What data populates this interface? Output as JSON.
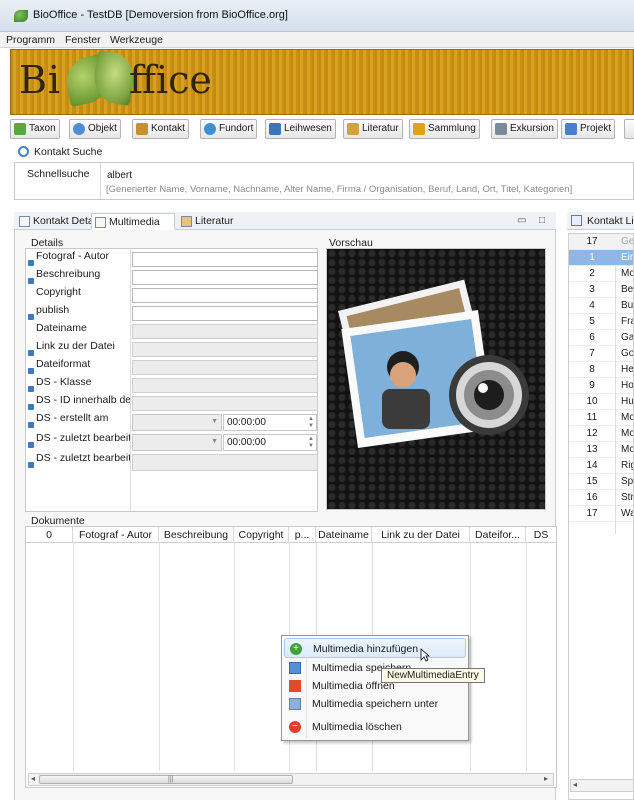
{
  "window": {
    "title": "BioOffice - TestDB [Demoversion from BioOffice.org]"
  },
  "menu": [
    "Programm",
    "Fenster",
    "Werkzeuge"
  ],
  "banner": {
    "wordmark_left": "Bi",
    "wordmark_right": "ffice"
  },
  "toolbar": [
    {
      "label": "Taxon",
      "icon": "taxon-icon",
      "color": "#5aa83c"
    },
    {
      "label": "Objekt",
      "icon": "objekt-icon",
      "color": "#4f8fd6"
    },
    {
      "label": "Kontakt",
      "icon": "kontakt-icon",
      "color": "#c7902a"
    },
    {
      "label": "Fundort",
      "icon": "fundort-icon",
      "color": "#3f8fd0"
    },
    {
      "label": "Leihwesen",
      "icon": "leihwesen-icon",
      "color": "#3a77b8"
    },
    {
      "label": "Literatur",
      "icon": "literatur-icon",
      "color": "#d8a03a"
    },
    {
      "label": "Sammlung",
      "icon": "sammlung-icon",
      "color": "#e0a219"
    },
    {
      "label": "Exkursion",
      "icon": "exkursion-icon",
      "color": "#7a8a99"
    },
    {
      "label": "Projekt",
      "icon": "projekt-icon",
      "color": "#4a7ed0"
    }
  ],
  "search": {
    "tab_label": "Kontakt Suche",
    "quick_label": "Schnellsuche",
    "value": "albert",
    "hint": "[Generierter Name, Vorname, Nachname, Alter Name, Firma / Organisation, Beruf, Land, Ort, Titel, Kategorien]"
  },
  "tabs": [
    {
      "label": "Kontakt Detail",
      "active": false
    },
    {
      "label": "Multimedia",
      "active": true
    },
    {
      "label": "Literatur",
      "active": false
    }
  ],
  "details": {
    "title": "Details",
    "fields": [
      {
        "label": "Fotograf - Autor",
        "info": true,
        "kind": "input"
      },
      {
        "label": "Beschreibung",
        "info": true,
        "kind": "input"
      },
      {
        "label": "Copyright",
        "info": false,
        "kind": "input"
      },
      {
        "label": "publish",
        "info": true,
        "kind": "input"
      },
      {
        "label": "Dateiname",
        "info": false,
        "kind": "readonly"
      },
      {
        "label": "Link zu der Datei",
        "info": true,
        "kind": "readonly"
      },
      {
        "label": "Dateiformat",
        "info": true,
        "kind": "readonly"
      },
      {
        "label": "DS - Klasse",
        "info": true,
        "kind": "readonly"
      },
      {
        "label": "DS - ID innerhalb der",
        "info": true,
        "kind": "readonly"
      },
      {
        "label": "DS - erstellt am",
        "info": true,
        "kind": "datetime",
        "time": "00:00:00"
      },
      {
        "label": "DS - zuletzt bearbeite",
        "info": true,
        "kind": "datetime",
        "time": "00:00:00"
      },
      {
        "label": "DS - zuletzt bearbeite",
        "info": true,
        "kind": "readonly"
      }
    ]
  },
  "preview": {
    "title": "Vorschau"
  },
  "documents": {
    "title": "Dokumente",
    "columns": [
      "0",
      "Fotograf - Autor",
      "Beschreibung",
      "Copyright",
      "p...",
      "Dateiname",
      "Link zu der Datei",
      "Dateifor...",
      "DS"
    ]
  },
  "context_menu": [
    {
      "label": "Multimedia hinzufügen",
      "icon": "add-icon",
      "highlighted": true
    },
    {
      "label": "Multimedia speichern",
      "icon": "save-icon",
      "highlighted": false
    },
    {
      "label": "Multimedia öffnen",
      "icon": "open-icon",
      "highlighted": false
    },
    {
      "label": "Multimedia speichern unter",
      "icon": "save-as-icon",
      "highlighted": false
    },
    {
      "label": "Multimedia löschen",
      "icon": "delete-icon",
      "highlighted": false
    }
  ],
  "tooltip": "NewMultimediaEntry",
  "contact_list": {
    "tab_label": "Kontakt Lis",
    "header": {
      "num": "17",
      "text": "Ge"
    },
    "rows": [
      {
        "num": "1",
        "text": "Ein",
        "selected": true
      },
      {
        "num": "2",
        "text": "Mc"
      },
      {
        "num": "3",
        "text": "Be"
      },
      {
        "num": "4",
        "text": "Bu"
      },
      {
        "num": "5",
        "text": "Fra"
      },
      {
        "num": "6",
        "text": "Ga"
      },
      {
        "num": "7",
        "text": "Go"
      },
      {
        "num": "8",
        "text": "He"
      },
      {
        "num": "9",
        "text": "Ho"
      },
      {
        "num": "10",
        "text": "Hu"
      },
      {
        "num": "11",
        "text": "Mc"
      },
      {
        "num": "12",
        "text": "Mc"
      },
      {
        "num": "13",
        "text": "Mc"
      },
      {
        "num": "14",
        "text": "Rig"
      },
      {
        "num": "15",
        "text": "Sp"
      },
      {
        "num": "16",
        "text": "Str"
      },
      {
        "num": "17",
        "text": "Wa"
      }
    ]
  }
}
